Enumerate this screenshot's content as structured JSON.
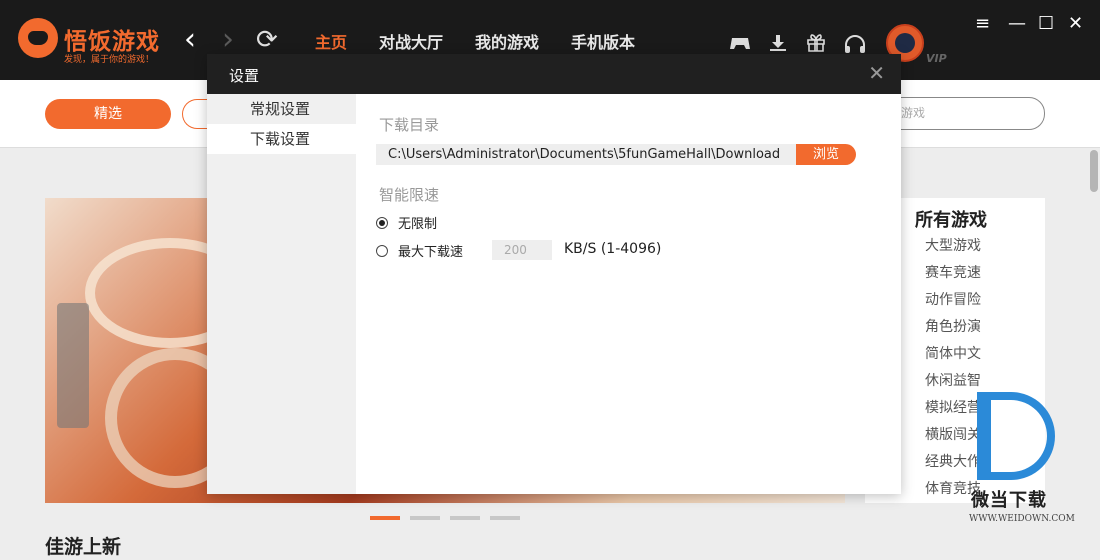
{
  "header": {
    "logo_title": "悟饭游戏",
    "logo_slogan": "发现，属于你的游戏！",
    "back_icon": "‹",
    "forward_icon": "›",
    "refresh_icon": "⟳",
    "tabs": [
      {
        "label": "主页",
        "active": true
      },
      {
        "label": "对战大厅",
        "active": false
      },
      {
        "label": "我的游戏",
        "active": false
      },
      {
        "label": "手机版本",
        "active": false
      }
    ],
    "icons": [
      "gamepad-icon",
      "download-icon",
      "gift-icon",
      "headset-icon"
    ],
    "vip_label": "VIP",
    "window_controls": {
      "menu": "≡",
      "minimize": "—",
      "maximize": "☐",
      "close": "✕"
    }
  },
  "filter": {
    "active_pill": "精选",
    "search_placeholder": "的游戏"
  },
  "side_panel": {
    "title": "所有游戏",
    "items": [
      "大型游戏",
      "赛车竞速",
      "动作冒险",
      "角色扮演",
      "简体中文",
      "休闲益智",
      "模拟经营",
      "横版闯关",
      "经典大作",
      "体育竞技"
    ]
  },
  "section_title": "佳游上新",
  "carousel_dots": 4,
  "carousel_active": 0,
  "watermark": {
    "name": "微当下载",
    "url": "WWW.WEIDOWN.COM"
  },
  "dialog": {
    "title": "设置",
    "close_icon": "✕",
    "nav": [
      {
        "label": "常规设置",
        "active": false
      },
      {
        "label": "下载设置",
        "active": true
      }
    ],
    "download_dir_label": "下载目录",
    "download_path": "C:\\Users\\Administrator\\Documents\\5funGameHall\\Download",
    "browse_label": "浏览",
    "speed_label": "智能限速",
    "option_unlimited": "无限制",
    "option_max": "最大下载速",
    "speed_value": "200",
    "speed_unit": "KB/S (1-4096)",
    "selected_option": "unlimited"
  },
  "colors": {
    "accent": "#f26a2e",
    "topbar": "#1a1a1a",
    "dialog_header": "#202020"
  }
}
